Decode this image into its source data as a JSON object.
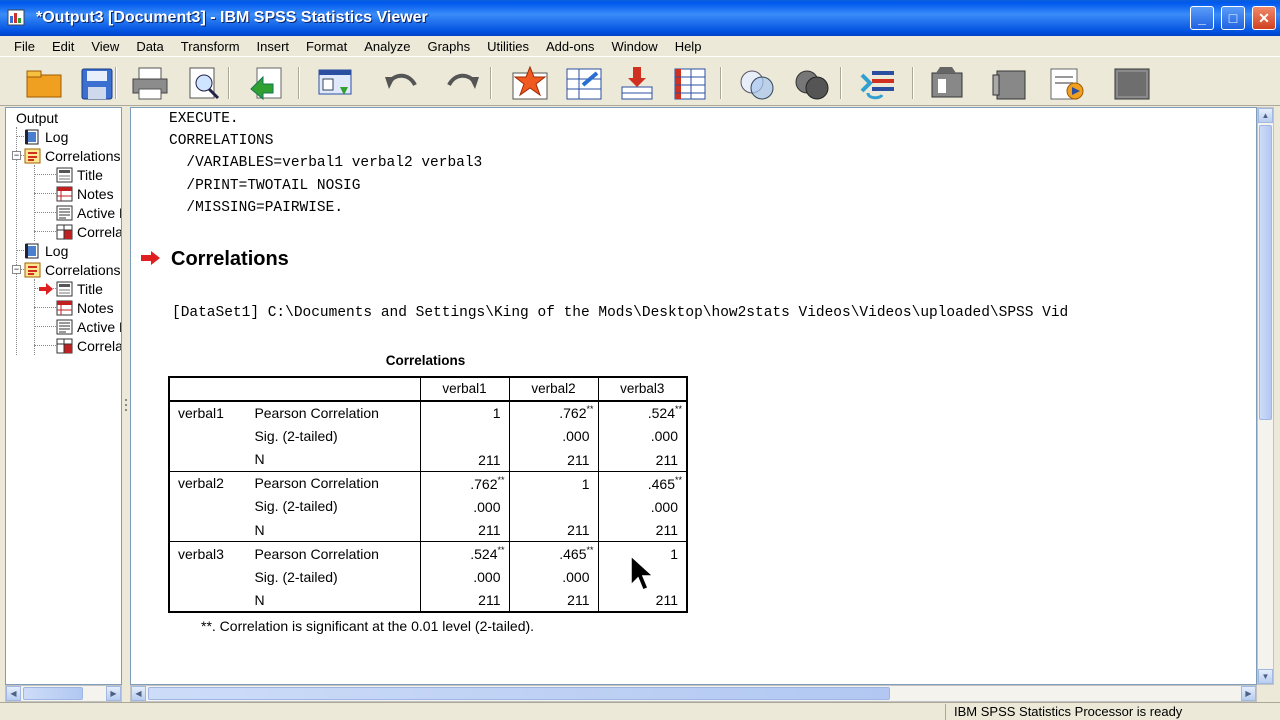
{
  "window": {
    "title": "*Output3 [Document3] - IBM SPSS Statistics Viewer",
    "min": "_",
    "max": "□",
    "close": "✕"
  },
  "menu": [
    "File",
    "Edit",
    "View",
    "Data",
    "Transform",
    "Insert",
    "Format",
    "Analyze",
    "Graphs",
    "Utilities",
    "Add-ons",
    "Window",
    "Help"
  ],
  "toolbar": [
    "open-icon",
    "save-icon",
    "print-icon",
    "print-preview-icon",
    "export-icon",
    "recall-dialog-icon",
    "undo-icon",
    "redo-icon",
    "goto-data-icon",
    "goto-case-icon",
    "goto-variable-icon",
    "variables-icon",
    "venn-icon",
    "circles-icon",
    "designate-window-icon",
    "promote-icon",
    "demote-icon",
    "expand-icon",
    "collapse-icon",
    "show-icon"
  ],
  "outline": {
    "root": "Output",
    "items": [
      {
        "label": "Log",
        "level": 1,
        "icon": "log-icon"
      },
      {
        "label": "Correlations",
        "level": 1,
        "icon": "procedure-icon"
      },
      {
        "label": "Title",
        "level": 2,
        "icon": "title-icon"
      },
      {
        "label": "Notes",
        "level": 2,
        "icon": "notes-icon"
      },
      {
        "label": "Active Dataset",
        "level": 2,
        "icon": "text-icon"
      },
      {
        "label": "Correlations",
        "level": 2,
        "icon": "table-icon"
      },
      {
        "label": "Log",
        "level": 1,
        "icon": "log-icon"
      },
      {
        "label": "Correlations",
        "level": 1,
        "icon": "procedure-icon"
      },
      {
        "label": "Title",
        "level": 2,
        "icon": "title-icon",
        "current": true
      },
      {
        "label": "Notes",
        "level": 2,
        "icon": "notes-icon"
      },
      {
        "label": "Active Dataset",
        "level": 2,
        "icon": "text-icon"
      },
      {
        "label": "Correlations",
        "level": 2,
        "icon": "table-icon"
      }
    ]
  },
  "syntax": [
    "EXECUTE.",
    "CORRELATIONS",
    "  /VARIABLES=verbal1 verbal2 verbal3",
    "  /PRINT=TWOTAIL NOSIG",
    "  /MISSING=PAIRWISE."
  ],
  "heading": "Correlations",
  "dataset_line": "[DataSet1] C:\\Documents and Settings\\King of the Mods\\Desktop\\how2stats Videos\\Videos\\uploaded\\SPSS Vid",
  "table": {
    "title": "Correlations",
    "columns": [
      "verbal1",
      "verbal2",
      "verbal3"
    ],
    "stat_labels": [
      "Pearson Correlation",
      "Sig. (2-tailed)",
      "N"
    ],
    "rows": [
      {
        "var": "verbal1",
        "cells": [
          [
            "1",
            ".762",
            ".524"
          ],
          [
            "",
            ".000",
            ".000"
          ],
          [
            "211",
            "211",
            "211"
          ]
        ],
        "flags": [
          [
            "",
            "**",
            "**"
          ],
          [
            "",
            "",
            ""
          ],
          [
            "",
            "",
            ""
          ]
        ]
      },
      {
        "var": "verbal2",
        "cells": [
          [
            ".762",
            "1",
            ".465"
          ],
          [
            ".000",
            "",
            ".000"
          ],
          [
            "211",
            "211",
            "211"
          ]
        ],
        "flags": [
          [
            "**",
            "",
            "**"
          ],
          [
            "",
            "",
            ""
          ],
          [
            "",
            "",
            ""
          ]
        ]
      },
      {
        "var": "verbal3",
        "cells": [
          [
            ".524",
            ".465",
            "1"
          ],
          [
            ".000",
            ".000",
            ""
          ],
          [
            "211",
            "211",
            "211"
          ]
        ],
        "flags": [
          [
            "**",
            "**",
            ""
          ],
          [
            "",
            "",
            ""
          ],
          [
            "",
            "",
            ""
          ]
        ]
      }
    ],
    "footnote": "**. Correlation is significant at the 0.01 level (2-tailed)."
  },
  "status": "IBM SPSS Statistics Processor is ready",
  "colors": {
    "title_bar": "#0058ee",
    "heading_arrow": "#e02020",
    "window_bg": "#ece9d8"
  }
}
